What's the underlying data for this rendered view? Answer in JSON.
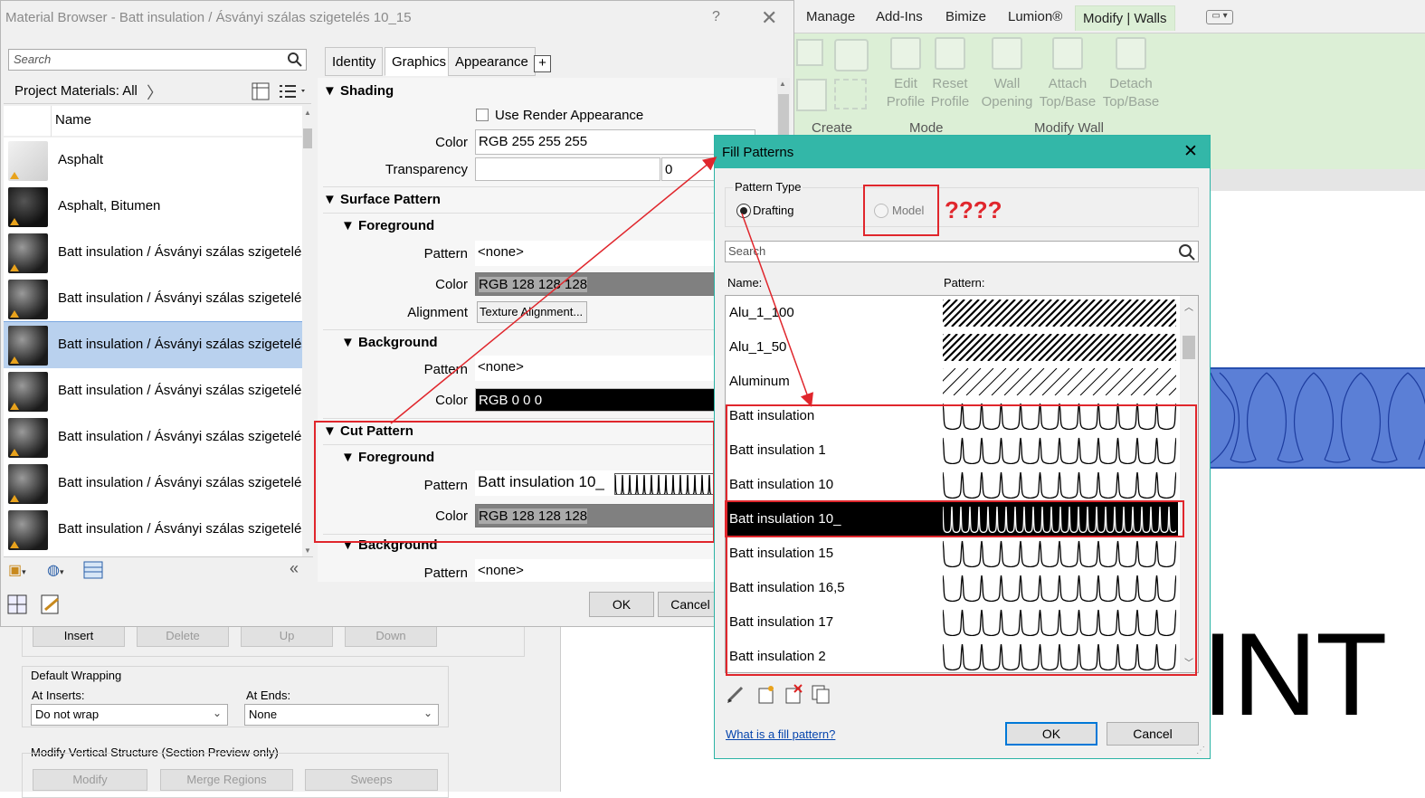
{
  "ribbon": {
    "tabs": [
      "Manage",
      "Add-Ins",
      "Bimize",
      "Lumion®",
      "Modify | Walls"
    ],
    "buttons": [
      {
        "line1": "Edit",
        "line2": "Profile"
      },
      {
        "line1": "Reset",
        "line2": "Profile"
      },
      {
        "line1": "Wall",
        "line2": "Opening"
      },
      {
        "line1": "Attach",
        "line2": "Top/Base"
      },
      {
        "line1": "Detach",
        "line2": "Top/Base"
      }
    ],
    "groups": [
      "Create",
      "Mode",
      "Modify Wall"
    ]
  },
  "canvas": {
    "big_text": "INT"
  },
  "assembly_dialog": {
    "buttons": [
      "Insert",
      "Delete",
      "Up",
      "Down"
    ],
    "default_wrapping_label": "Default Wrapping",
    "at_inserts_label": "At Inserts:",
    "at_inserts_value": "Do not wrap",
    "at_ends_label": "At  Ends:",
    "at_ends_value": "None",
    "vertical_label": "Modify Vertical Structure (Section Preview only)",
    "vertical_buttons": [
      "Modify",
      "Merge Regions",
      "Sweeps"
    ]
  },
  "material_browser": {
    "title": "Material Browser - Batt insulation / Ásványi szálas szigetelés 10_15",
    "help": "?",
    "search_placeholder": "Search",
    "project_filter": "Project Materials: All",
    "column_name": "Name",
    "materials": [
      {
        "name": "Asphalt",
        "thumb": "light",
        "selected": false
      },
      {
        "name": "Asphalt, Bitumen",
        "thumb": "dark",
        "selected": false
      },
      {
        "name": "Batt insulation / Ásványi szálas szigetelés",
        "thumb": "sphere",
        "selected": false
      },
      {
        "name": "Batt insulation / Ásványi szálas szigetelés",
        "thumb": "sphere",
        "selected": false
      },
      {
        "name": "Batt insulation / Ásványi szálas szigetelés",
        "thumb": "sphere",
        "selected": true
      },
      {
        "name": "Batt insulation / Ásványi szálas szigetelés",
        "thumb": "sphere",
        "selected": false
      },
      {
        "name": "Batt insulation / Ásványi szálas szigetelés",
        "thumb": "sphere",
        "selected": false
      },
      {
        "name": "Batt insulation / Ásványi szálas szigetelés",
        "thumb": "sphere",
        "selected": false
      },
      {
        "name": "Batt insulation / Ásványi szálas szigetelés",
        "thumb": "sphere",
        "selected": false
      }
    ],
    "tabs": [
      "Identity",
      "Graphics",
      "Appearance",
      "+"
    ],
    "active_tab": "Graphics",
    "shading": {
      "header": "Shading",
      "use_render_label": "Use Render Appearance",
      "color_label": "Color",
      "color_value": "RGB 255 255 255",
      "transparency_label": "Transparency",
      "transparency_value": "0"
    },
    "surface_pattern": {
      "header": "Surface Pattern",
      "foreground": "Foreground",
      "pattern_label": "Pattern",
      "pattern_value": "<none>",
      "color_label": "Color",
      "color_value": "RGB 128 128 128",
      "alignment_label": "Alignment",
      "alignment_button": "Texture Alignment...",
      "background": "Background",
      "bg_pattern_label": "Pattern",
      "bg_pattern_value": "<none>",
      "bg_color_label": "Color",
      "bg_color_value": "RGB 0 0 0"
    },
    "cut_pattern": {
      "header": "Cut Pattern",
      "foreground": "Foreground",
      "pattern_label": "Pattern",
      "pattern_value": "Batt insulation 10_",
      "color_label": "Color",
      "color_value": "RGB 128 128 128",
      "background": "Background",
      "bg_pattern_label": "Pattern",
      "bg_pattern_value": "<none>"
    },
    "ok": "OK",
    "cancel": "Cancel"
  },
  "fill_patterns": {
    "title": "Fill Patterns",
    "pattern_type_label": "Pattern Type",
    "drafting_label": "Drafting",
    "model_label": "Model",
    "annotation": "????",
    "search_placeholder": "Search",
    "col_name": "Name:",
    "col_pattern": "Pattern:",
    "rows": [
      {
        "name": "Alu_1_100",
        "kind": "diag-dense",
        "selected": false
      },
      {
        "name": "Alu_1_50",
        "kind": "diag-dense",
        "selected": false
      },
      {
        "name": "Aluminum",
        "kind": "diag-sparse",
        "selected": false
      },
      {
        "name": "Batt insulation",
        "kind": "batt",
        "selected": false
      },
      {
        "name": "Batt insulation 1",
        "kind": "batt",
        "selected": false
      },
      {
        "name": "Batt insulation 10",
        "kind": "batt",
        "selected": false
      },
      {
        "name": "Batt insulation 10_",
        "kind": "batt-small",
        "selected": true
      },
      {
        "name": "Batt insulation 15",
        "kind": "batt",
        "selected": false
      },
      {
        "name": "Batt insulation 16,5",
        "kind": "batt",
        "selected": false
      },
      {
        "name": "Batt insulation 17",
        "kind": "batt",
        "selected": false
      },
      {
        "name": "Batt insulation 2",
        "kind": "batt",
        "selected": false
      }
    ],
    "help_link": "What is a fill pattern?",
    "ok": "OK",
    "cancel": "Cancel"
  },
  "colors": {
    "ribbon_green": "#dcefd6",
    "teal_title": "#33b7a8",
    "annotation_red": "#e0262c",
    "wall_blue": "#5b7fd6",
    "selection_blue": "#b9d1ee"
  }
}
